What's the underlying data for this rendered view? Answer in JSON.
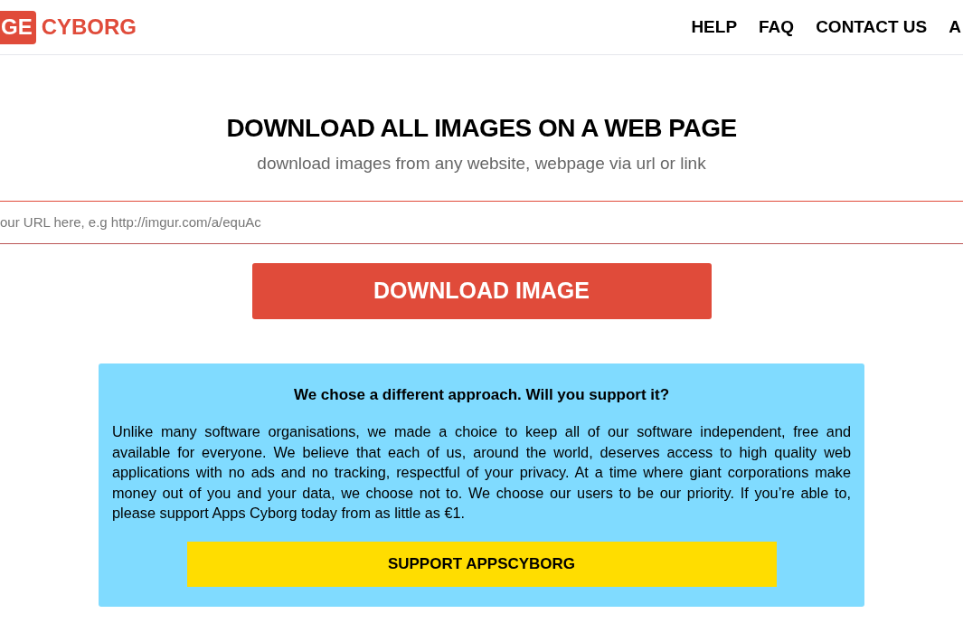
{
  "header": {
    "logo_mark": "GE",
    "logo_text": "CYBORG",
    "nav": [
      "HELP",
      "FAQ",
      "CONTACT US",
      "A"
    ]
  },
  "hero": {
    "title": "DOWNLOAD ALL IMAGES ON A WEB PAGE",
    "subtitle": "download images from any website, webpage via url or link"
  },
  "url_field": {
    "placeholder": "our URL here, e.g http://imgur.com/a/equAc"
  },
  "download_button": "DOWNLOAD IMAGE",
  "support": {
    "heading": "We chose a different approach. Will you support it?",
    "body": "Unlike many software organisations, we made a choice to keep all of our software independent, free and available for everyone. We believe that each of us, around the world, deserves access to high quality web applications with no ads and no tracking, respectful of your privacy. At a time where giant corporations make money out of you and your data, we choose not to. We choose our users to be our priority. If you’re able to, please support Apps Cyborg today from as little as €1.",
    "button": "SUPPORT APPSCYBORG"
  }
}
